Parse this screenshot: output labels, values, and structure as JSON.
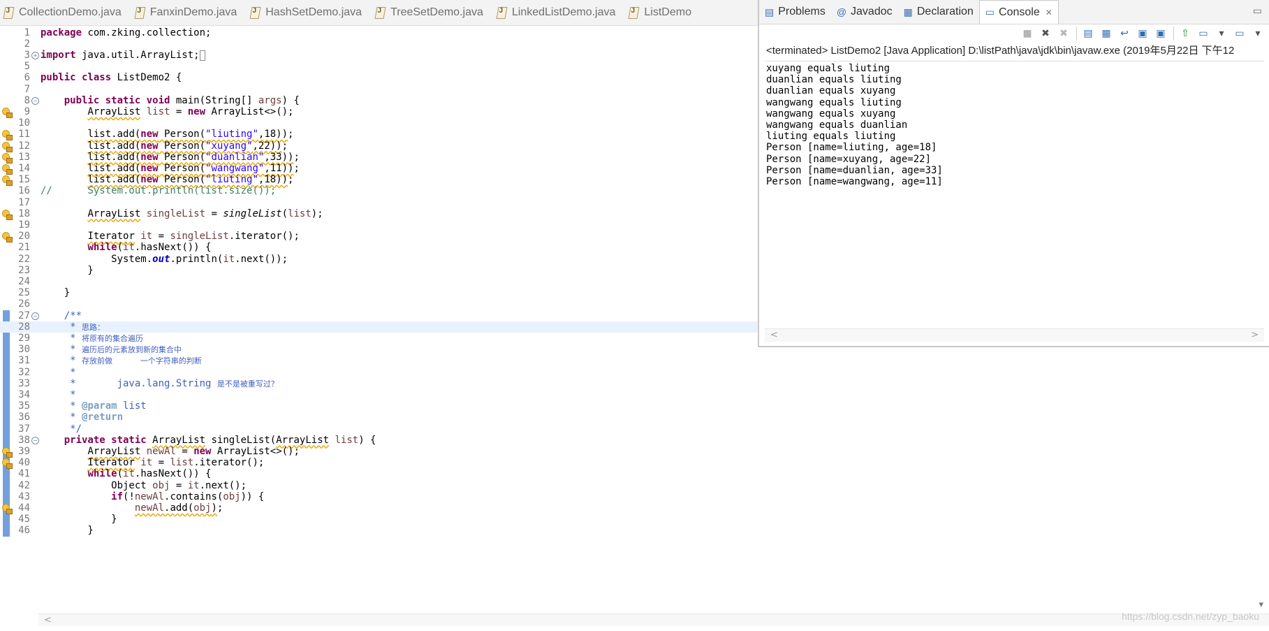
{
  "editor_tabs": [
    {
      "label": "CollectionDemo.java"
    },
    {
      "label": "FanxinDemo.java"
    },
    {
      "label": "HashSetDemo.java"
    },
    {
      "label": "TreeSetDemo.java"
    },
    {
      "label": "LinkedListDemo.java"
    },
    {
      "label": "ListDemo"
    }
  ],
  "code_lines": [
    {
      "n": "1",
      "html": "<span class=\"kw\">package</span> com.zking.collection;"
    },
    {
      "n": "2",
      "html": ""
    },
    {
      "n": "3",
      "fold": "+",
      "html": "<span class=\"kw\">import</span> java.util.ArrayList;<span style=\"border:1px solid #888;font-size:11px\">&nbsp;</span>"
    },
    {
      "n": "5",
      "html": ""
    },
    {
      "n": "6",
      "html": "<span class=\"kw\">public class</span> ListDemo2 {"
    },
    {
      "n": "7",
      "html": ""
    },
    {
      "n": "8",
      "fold": "-",
      "html": "    <span class=\"kw\">public static void</span> main(String[] <span class=\"var\">args</span>) {"
    },
    {
      "n": "9",
      "bulb": true,
      "html": "        <span class=\"wv\">ArrayList</span> <span class=\"var\">list</span> = <span class=\"kw\">new</span> ArrayList&lt;&gt;();"
    },
    {
      "n": "10",
      "html": ""
    },
    {
      "n": "11",
      "bulb": true,
      "html": "        <span class=\"wv\">list.add(<span class=\"kw\">new</span> Person(<span class=\"str\">\"liuting\"</span>,18))</span>;"
    },
    {
      "n": "12",
      "bulb": true,
      "html": "        <span class=\"wv\">list.add(<span class=\"kw\">new</span> Person(<span class=\"str\">\"xuyang\"</span>,22))</span>;"
    },
    {
      "n": "13",
      "bulb": true,
      "html": "        <span class=\"wv\">list.add(<span class=\"kw\">new</span> Person(<span class=\"str\">\"duanlian\"</span>,33))</span>;"
    },
    {
      "n": "14",
      "bulb": true,
      "html": "        <span class=\"wv\">list.add(<span class=\"kw\">new</span> Person(<span class=\"str\">\"wangwang\"</span>,11))</span>;"
    },
    {
      "n": "15",
      "bulb": true,
      "html": "        <span class=\"wv\">list.add(<span class=\"kw\">new</span> Person(<span class=\"str\">\"liuting\"</span>,18))</span>;"
    },
    {
      "n": "16",
      "html": "<span class=\"com\">//      System.out.println(list.size());</span>"
    },
    {
      "n": "17",
      "html": ""
    },
    {
      "n": "18",
      "bulb": true,
      "html": "        <span class=\"wv\">ArrayList</span> <span class=\"var\">singleList</span> = <span class=\"ital\">singleList</span>(<span class=\"var\">list</span>);"
    },
    {
      "n": "19",
      "html": ""
    },
    {
      "n": "20",
      "bulb": true,
      "html": "        <span class=\"wv\">Iterator</span> <span class=\"var\">it</span> = <span class=\"var\">singleList</span>.iterator();"
    },
    {
      "n": "21",
      "html": "        <span class=\"kw\">while</span>(<span class=\"var\">it</span>.hasNext()) {"
    },
    {
      "n": "22",
      "html": "            System.<span class=\"fld\">out</span>.println(<span class=\"var\">it</span>.next());"
    },
    {
      "n": "23",
      "html": "        }"
    },
    {
      "n": "24",
      "html": ""
    },
    {
      "n": "25",
      "html": "    }"
    },
    {
      "n": "26",
      "html": ""
    },
    {
      "n": "27",
      "fold": "-",
      "bar": true,
      "html": "    <span class=\"jd\">/**</span>"
    },
    {
      "n": "28",
      "bar": true,
      "current": true,
      "html": "<span class=\"jd\">     * </span><span class=\"cn\">思路：</span>"
    },
    {
      "n": "29",
      "bar": true,
      "html": "<span class=\"jd\">     * </span><span class=\"cn\">将原有的集合遍历</span>"
    },
    {
      "n": "30",
      "bar": true,
      "html": "<span class=\"jd\">     * </span><span class=\"cn\">遍历后的元素放到新的集合中</span>"
    },
    {
      "n": "31",
      "bar": true,
      "html": "<span class=\"jd\">     * </span><span class=\"cn\">存放前做      一个字符串的判断</span>"
    },
    {
      "n": "32",
      "bar": true,
      "html": "<span class=\"jd\">     *</span>"
    },
    {
      "n": "33",
      "bar": true,
      "html": "<span class=\"jd\">     *       java.lang.String </span><span class=\"cn\">是不是被重写过？</span>"
    },
    {
      "n": "34",
      "bar": true,
      "html": "<span class=\"jd\">     *</span>"
    },
    {
      "n": "35",
      "bar": true,
      "html": "<span class=\"jd\">     * </span><span class=\"jtag\">@param</span><span class=\"jd\"> list</span>"
    },
    {
      "n": "36",
      "bar": true,
      "html": "<span class=\"jd\">     * </span><span class=\"jtag\">@return</span>"
    },
    {
      "n": "37",
      "bar": true,
      "html": "<span class=\"jd\">     */</span>"
    },
    {
      "n": "38",
      "fold": "-",
      "bar": true,
      "html": "    <span class=\"kw\">private static</span> <span class=\"wv\">ArrayList</span> singleList(<span class=\"wv\">ArrayList</span> <span class=\"var\">list</span>) {"
    },
    {
      "n": "39",
      "bulb": true,
      "bar": true,
      "html": "        <span class=\"wv\">ArrayList</span> <span class=\"var\">newAl</span> = <span class=\"kw\">new</span> ArrayList&lt;&gt;();"
    },
    {
      "n": "40",
      "bulb": true,
      "bar": true,
      "html": "        <span class=\"wv\">Iterator</span> <span class=\"var\">it</span> = <span class=\"var\">list</span>.iterator();"
    },
    {
      "n": "41",
      "bar": true,
      "html": "        <span class=\"kw\">while</span>(<span class=\"var\">it</span>.hasNext()) {"
    },
    {
      "n": "42",
      "bar": true,
      "html": "            Object <span class=\"var\">obj</span> = <span class=\"var\">it</span>.next();"
    },
    {
      "n": "43",
      "bar": true,
      "html": "            <span class=\"kw\">if</span>(!<span class=\"var\">newAl</span>.contains(<span class=\"var\">obj</span>)) {"
    },
    {
      "n": "44",
      "bulb": true,
      "bar": true,
      "html": "                <span class=\"wv\"><span class=\"var\">newAl</span>.add(<span class=\"var\">obj</span>)</span>;"
    },
    {
      "n": "45",
      "bar": true,
      "html": "            }"
    },
    {
      "n": "46",
      "bar": true,
      "html": "        }"
    }
  ],
  "console": {
    "tabs": [
      {
        "label": "Problems",
        "icon": "problems-icon",
        "glyph": "▤"
      },
      {
        "label": "Javadoc",
        "icon": "javadoc-icon",
        "glyph": "@"
      },
      {
        "label": "Declaration",
        "icon": "declaration-icon",
        "glyph": "▦"
      },
      {
        "label": "Console",
        "icon": "console-icon",
        "glyph": "▭",
        "active": true
      }
    ],
    "header": "<terminated> ListDemo2 [Java Application] D:\\listPath\\java\\jdk\\bin\\javaw.exe (2019年5月22日 下午12",
    "output": [
      "xuyang equals liuting",
      "duanlian equals liuting",
      "duanlian equals xuyang",
      "wangwang equals liuting",
      "wangwang equals xuyang",
      "wangwang equals duanlian",
      "liuting equals liuting",
      "Person [name=liuting, age=18]",
      "Person [name=xuyang, age=22]",
      "Person [name=duanlian, age=33]",
      "Person [name=wangwang, age=11]"
    ],
    "toolbar": [
      {
        "name": "terminate-icon",
        "glyph": "■",
        "cls": "dis"
      },
      {
        "name": "remove-launch-icon",
        "glyph": "✖",
        "cls": ""
      },
      {
        "name": "remove-all-terminated-icon",
        "glyph": "✖",
        "cls": "dis"
      },
      {
        "sep": true
      },
      {
        "name": "clear-console-icon",
        "glyph": "▤",
        "cls": "blue"
      },
      {
        "name": "scroll-lock-icon",
        "glyph": "▦",
        "cls": "blue"
      },
      {
        "name": "word-wrap-icon",
        "glyph": "↩",
        "cls": "blue"
      },
      {
        "name": "show-on-stdout-icon",
        "glyph": "▣",
        "cls": "blue"
      },
      {
        "name": "show-on-stderr-icon",
        "glyph": "▣",
        "cls": "blue"
      },
      {
        "sep": true
      },
      {
        "name": "pin-console-icon",
        "glyph": "⇧",
        "cls": "green"
      },
      {
        "name": "display-console-icon",
        "glyph": "▭",
        "cls": "blue"
      },
      {
        "name": "display-console-dropdown-icon",
        "glyph": "▾",
        "cls": ""
      },
      {
        "name": "open-console-icon",
        "glyph": "▭",
        "cls": "blue"
      },
      {
        "name": "open-console-dropdown-icon",
        "glyph": "▾",
        "cls": ""
      }
    ]
  },
  "watermark": "https://blog.csdn.net/zyp_baoku"
}
